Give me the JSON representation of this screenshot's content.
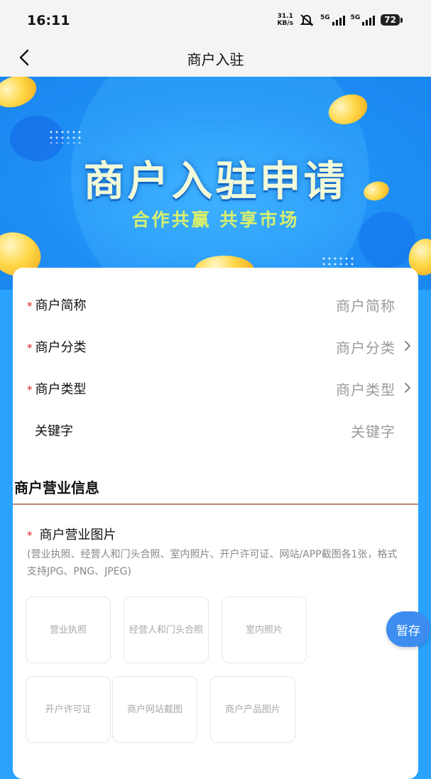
{
  "status": {
    "time": "16:11",
    "speed_value": "31.1",
    "speed_unit": "KB/s",
    "sim1": "5G",
    "sim2": "5G",
    "battery": "72"
  },
  "nav": {
    "title": "商户入驻"
  },
  "banner": {
    "title": "商户入驻申请",
    "subtitle": "合作共赢 共享市场"
  },
  "form": {
    "fields": [
      {
        "label": "商户简称",
        "required": true,
        "placeholder": "商户简称",
        "chevron": false
      },
      {
        "label": "商户分类",
        "required": true,
        "placeholder": "商户分类",
        "chevron": true
      },
      {
        "label": "商户类型",
        "required": true,
        "placeholder": "商户类型",
        "chevron": true
      },
      {
        "label": "关键字",
        "required": false,
        "placeholder": "关键字",
        "chevron": false
      }
    ],
    "required_mark": "*"
  },
  "business": {
    "section_title": "商户营业信息",
    "images_label": "商户营业图片",
    "hint": "(营业执照、经营人和门头合照、室内照片、开户许可证、网站/APP截图各1张，格式支持JPG、PNG、JPEG)",
    "tiles": [
      "营业执照",
      "经营人和门头合照",
      "室内照片",
      "开户许可证",
      "商户网站截图",
      "商户产品图片"
    ]
  },
  "fab": {
    "label": "暂存"
  },
  "colors": {
    "accent": "#3d8df0",
    "required": "#e02020",
    "banner": "#1e8ff5"
  }
}
